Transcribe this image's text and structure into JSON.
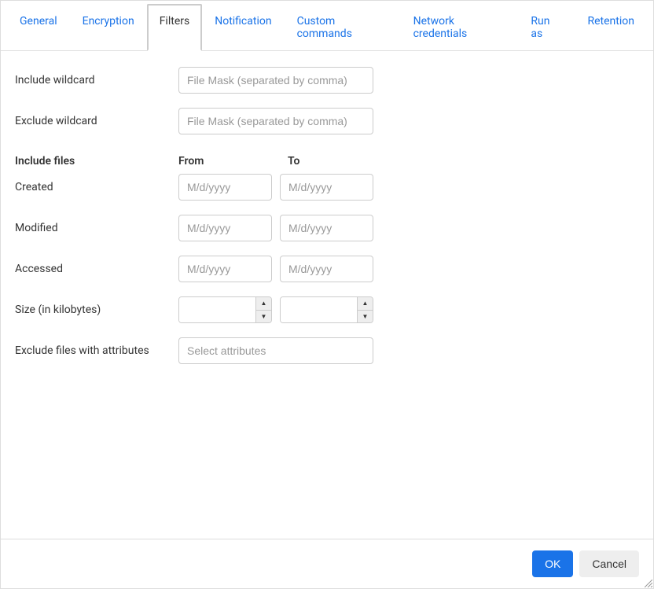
{
  "tabs": {
    "general": "General",
    "encryption": "Encryption",
    "filters": "Filters",
    "notification": "Notification",
    "custom_commands": "Custom commands",
    "network_credentials": "Network credentials",
    "run_as": "Run as",
    "retention": "Retention"
  },
  "labels": {
    "include_wildcard": "Include wildcard",
    "exclude_wildcard": "Exclude wildcard",
    "include_files": "Include files",
    "from": "From",
    "to": "To",
    "created": "Created",
    "modified": "Modified",
    "accessed": "Accessed",
    "size_kb": "Size (in kilobytes)",
    "exclude_attributes": "Exclude files with attributes"
  },
  "placeholders": {
    "file_mask": "File Mask (separated by comma)",
    "date": "M/d/yyyy",
    "select_attributes": "Select attributes"
  },
  "buttons": {
    "ok": "OK",
    "cancel": "Cancel"
  }
}
